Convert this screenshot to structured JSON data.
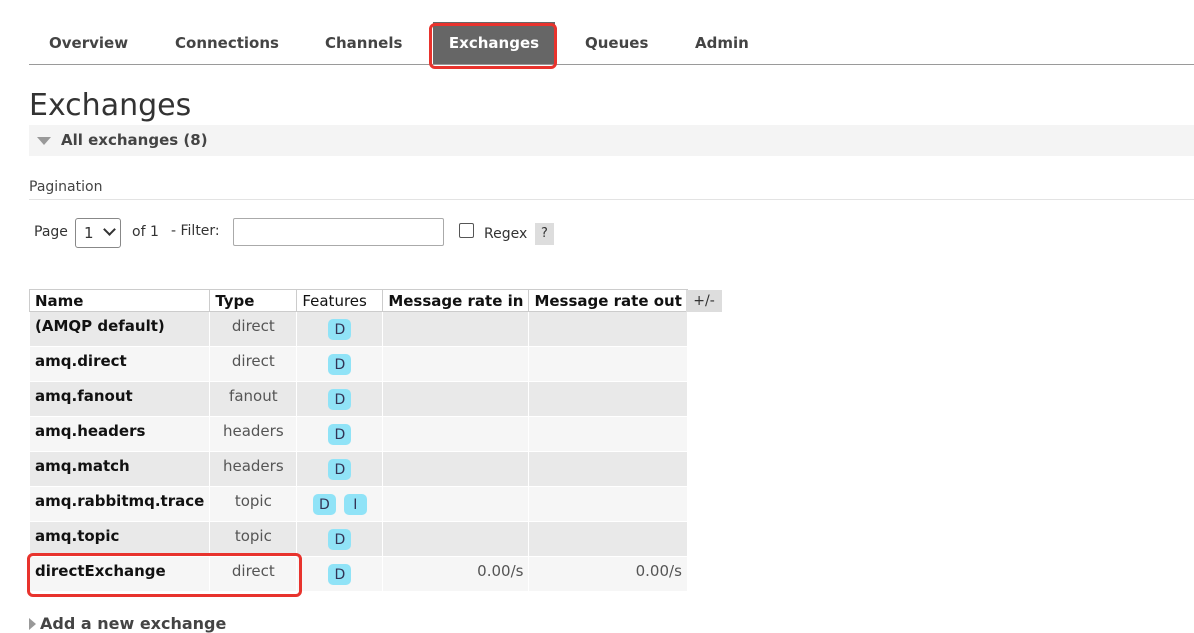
{
  "nav": {
    "tabs": [
      {
        "label": "Overview"
      },
      {
        "label": "Connections"
      },
      {
        "label": "Channels"
      },
      {
        "label": "Exchanges",
        "active": true
      },
      {
        "label": "Queues"
      },
      {
        "label": "Admin"
      }
    ]
  },
  "page": {
    "title": "Exchanges",
    "section_title": "All exchanges (8)"
  },
  "pagination": {
    "label": "Pagination",
    "page_label": "Page",
    "page_value": "1",
    "of_label": "of 1",
    "filter_label": "- Filter:",
    "filter_value": "",
    "regex_label": "Regex",
    "help_label": "?"
  },
  "table": {
    "headers": {
      "name": "Name",
      "type": "Type",
      "features": "Features",
      "rate_in": "Message rate in",
      "rate_out": "Message rate out"
    },
    "toggle_columns": "+/-",
    "rows": [
      {
        "name": "(AMQP default)",
        "type": "direct",
        "features": [
          "D"
        ],
        "rate_in": "",
        "rate_out": ""
      },
      {
        "name": "amq.direct",
        "type": "direct",
        "features": [
          "D"
        ],
        "rate_in": "",
        "rate_out": ""
      },
      {
        "name": "amq.fanout",
        "type": "fanout",
        "features": [
          "D"
        ],
        "rate_in": "",
        "rate_out": ""
      },
      {
        "name": "amq.headers",
        "type": "headers",
        "features": [
          "D"
        ],
        "rate_in": "",
        "rate_out": ""
      },
      {
        "name": "amq.match",
        "type": "headers",
        "features": [
          "D"
        ],
        "rate_in": "",
        "rate_out": ""
      },
      {
        "name": "amq.rabbitmq.trace",
        "type": "topic",
        "features": [
          "D",
          "I"
        ],
        "rate_in": "",
        "rate_out": ""
      },
      {
        "name": "amq.topic",
        "type": "topic",
        "features": [
          "D"
        ],
        "rate_in": "",
        "rate_out": ""
      },
      {
        "name": "directExchange",
        "type": "direct",
        "features": [
          "D"
        ],
        "rate_in": "0.00/s",
        "rate_out": "0.00/s"
      }
    ]
  },
  "add_section": {
    "label": "Add a new exchange"
  },
  "colors": {
    "active_tab": "#666666",
    "badge": "#90e3f7",
    "highlight": "#e8332d"
  }
}
